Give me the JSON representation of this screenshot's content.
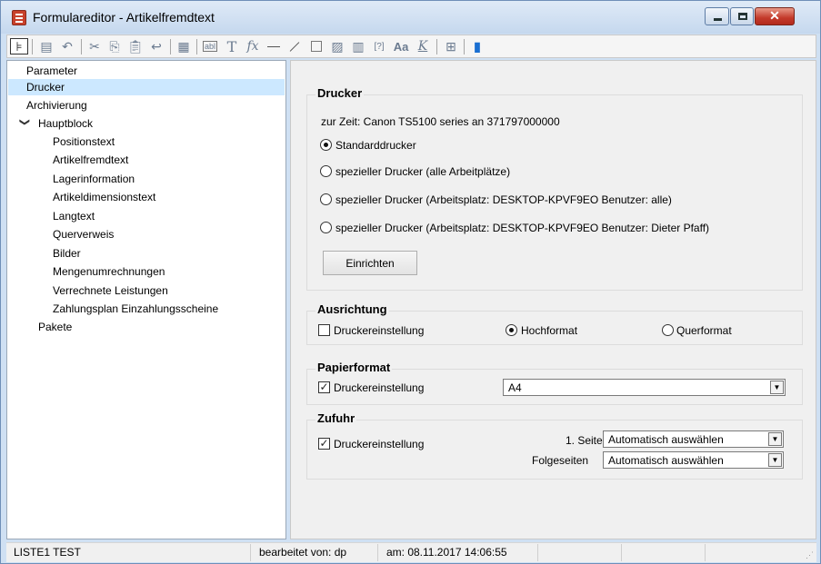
{
  "window": {
    "title": "Formulareditor - Artikelfremdtext",
    "icon": "form-editor-icon",
    "controls": {
      "minimize": "minimize-icon",
      "maximize": "maximize-icon",
      "close": "close-icon"
    }
  },
  "toolbar": {
    "icons": [
      "tree-view-icon",
      "save-icon",
      "undo-icon",
      "cut-icon",
      "copy-icon",
      "paste-icon",
      "undo-arrow-icon",
      "image-edit-icon",
      "text-field-icon",
      "text-icon",
      "formula-icon",
      "horizontal-line-icon",
      "diagonal-line-icon",
      "rectangle-icon",
      "image-icon",
      "table-icon",
      "placeholder-icon",
      "font-icon",
      "clear-format-icon",
      "tree-structure-icon",
      "book-icon"
    ]
  },
  "tree": {
    "items": [
      {
        "label": "Parameter",
        "level": 0
      },
      {
        "label": "Drucker",
        "level": 0,
        "selected": true
      },
      {
        "label": "Archivierung",
        "level": 0
      },
      {
        "label": "Hauptblock",
        "level": 0,
        "expanded": true
      },
      {
        "label": "Positionstext",
        "level": 1
      },
      {
        "label": "Artikelfremdtext",
        "level": 1
      },
      {
        "label": "Lagerinformation",
        "level": 1
      },
      {
        "label": "Artikeldimensionstext",
        "level": 1
      },
      {
        "label": "Langtext",
        "level": 1
      },
      {
        "label": "Querverweis",
        "level": 1
      },
      {
        "label": "Bilder",
        "level": 1
      },
      {
        "label": "Mengenumrechnungen",
        "level": 1
      },
      {
        "label": "Verrechnete Leistungen",
        "level": 1
      },
      {
        "label": "Zahlungsplan Einzahlungsscheine",
        "level": 1
      },
      {
        "label": "Pakete",
        "level": 0
      }
    ],
    "expand_glyph": "❯"
  },
  "drucker": {
    "title": "Drucker",
    "current": "zur Zeit: Canon TS5100 series an 371797000000",
    "options": [
      "Standarddrucker",
      "spezieller Drucker (alle Arbeitplätze)",
      "spezieller Drucker (Arbeitsplatz: DESKTOP-KPVF9EO Benutzer: alle)",
      "spezieller Drucker (Arbeitsplatz: DESKTOP-KPVF9EO Benutzer: Dieter Pfaff)"
    ],
    "selected_index": 0,
    "setup_button": "Einrichten"
  },
  "ausrichtung": {
    "title": "Ausrichtung",
    "printer_setting_label": "Druckereinstellung",
    "printer_setting_checked": false,
    "portrait": "Hochformat",
    "landscape": "Querformat",
    "selected": "portrait"
  },
  "papierformat": {
    "title": "Papierformat",
    "printer_setting_label": "Druckereinstellung",
    "printer_setting_checked": true,
    "format_value": "A4"
  },
  "zufuhr": {
    "title": "Zufuhr",
    "printer_setting_label": "Druckereinstellung",
    "printer_setting_checked": true,
    "first_page_label": "1. Seite",
    "first_page_value": "Automatisch auswählen",
    "following_label": "Folgeseiten",
    "following_value": "Automatisch auswählen"
  },
  "status": {
    "layout": "LISTE1 TEST",
    "edited_by": "bearbeitet von: dp",
    "date": "am: 08.11.2017 14:06:55"
  },
  "colors": {
    "selection": "#cce8ff",
    "titlebar": "#cfe0f3",
    "close": "#c3392a"
  }
}
